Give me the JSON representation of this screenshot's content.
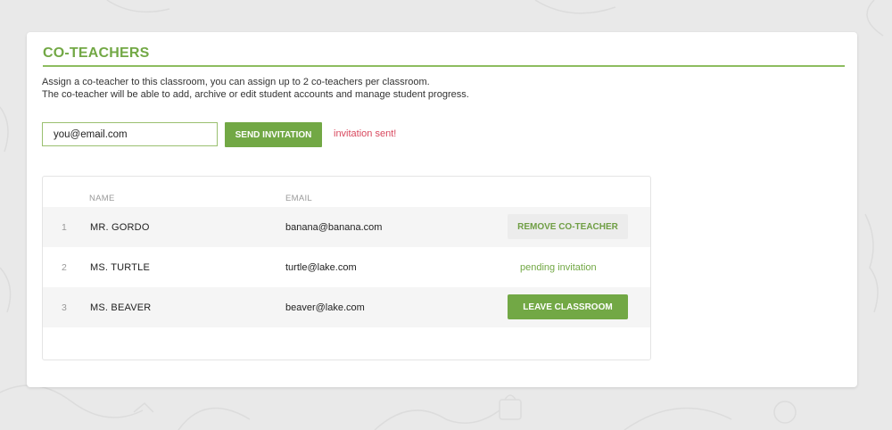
{
  "coteachers": {
    "title": "CO-TEACHERS",
    "description": [
      "Assign a co-teacher to this classroom, you can assign up to 2 co-teachers per classroom.",
      "The co-teacher will be able to add, archive or edit student accounts and manage student progress."
    ],
    "invite": {
      "email_value": "you@email.com",
      "send_label": "SEND INVITATION",
      "status": "invitation sent!"
    },
    "table": {
      "columns": [
        "NAME",
        "EMAIL"
      ],
      "rows": [
        {
          "num": "1",
          "name": "MR. GORDO",
          "email": "banana@banana.com",
          "action": "REMOVE CO-TEACHER"
        },
        {
          "num": "2",
          "name": "MS. TURTLE",
          "email": "turtle@lake.com",
          "status": "pending invitation"
        },
        {
          "num": "3",
          "name": "MS. BEAVER",
          "email": "beaver@lake.com",
          "action": "LEAVE CLASSROOM"
        }
      ]
    }
  },
  "colors": {
    "accent_green": "#72a845",
    "status_red": "#d8475d",
    "page_background": "#e9e9e9"
  }
}
